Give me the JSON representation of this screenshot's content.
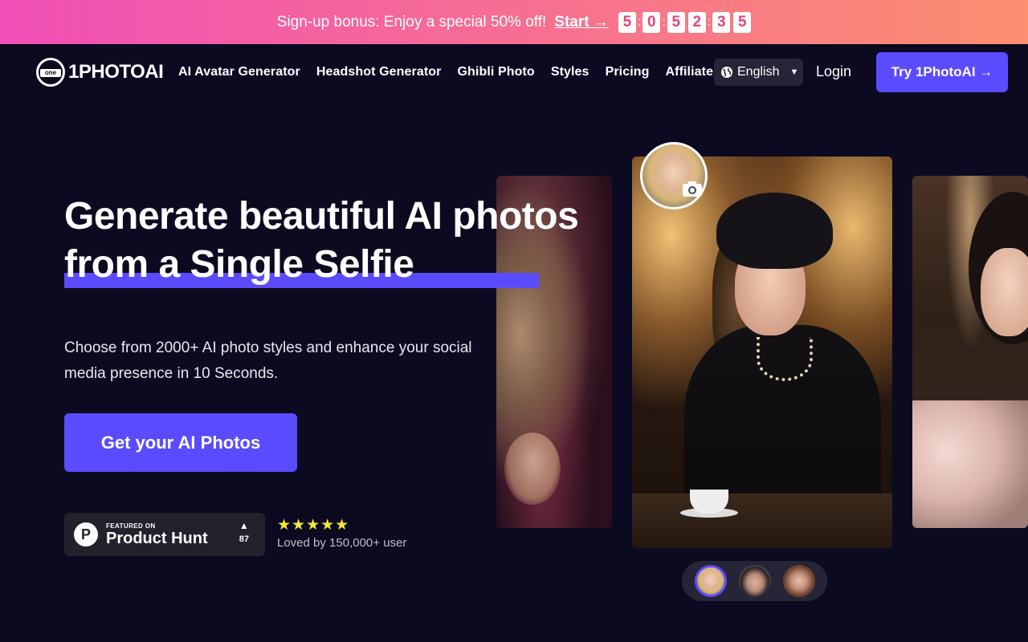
{
  "promo": {
    "text": "Sign-up bonus: Enjoy a special 50% off!",
    "start_label": "Start →",
    "countdown": [
      "5",
      "0",
      "5",
      "2",
      "3",
      "5"
    ]
  },
  "nav": {
    "logo_text": "1PHOTOAI",
    "logo_mark_text": "one",
    "links": [
      "AI Avatar Generator",
      "Headshot Generator",
      "Ghibli Photo",
      "Styles",
      "Pricing",
      "Affiliates"
    ],
    "language": "English",
    "login": "Login",
    "try_button": "Try 1PhotoAI →"
  },
  "hero": {
    "title_line1": "Generate beautiful AI photos",
    "title_line2": "from a Single Selfie",
    "subtitle": "Choose from 2000+ AI photo styles and enhance your social media presence in 10 Seconds.",
    "cta": "Get your AI Photos"
  },
  "product_hunt": {
    "featured_label": "FEATURED ON",
    "name": "Product Hunt",
    "logo_letter": "P",
    "vote_icon": "▲",
    "votes": "87"
  },
  "rating": {
    "stars": "★★★★★",
    "loved_text": "Loved by 150,000+ user"
  },
  "colors": {
    "accent": "#5b4bff",
    "background": "#0b0a20",
    "banner_start": "#f04fb6",
    "banner_end": "#fb8f6f",
    "stars": "#f7e53a"
  },
  "icons": [
    "globe-icon",
    "chevron-down-icon",
    "camera-icon",
    "upvote-icon"
  ]
}
